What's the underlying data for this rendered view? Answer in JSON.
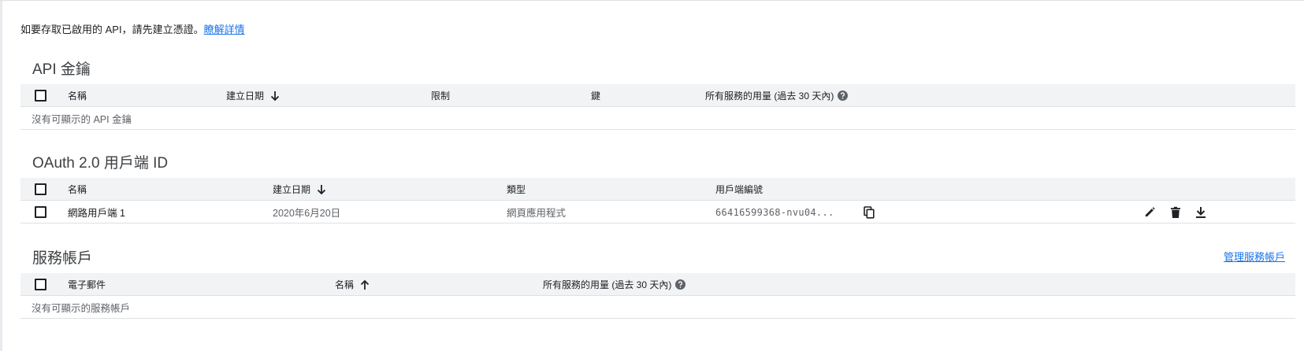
{
  "intro": {
    "text": "如要存取已啟用的 API，請先建立憑證。",
    "link": "瞭解詳情"
  },
  "api_keys": {
    "title": "API 金鑰",
    "headers": {
      "name": "名稱",
      "created": "建立日期",
      "restrictions": "限制",
      "key": "鍵",
      "usage": "所有服務的用量 (過去 30 天內)"
    },
    "empty": "沒有可顯示的 API 金鑰"
  },
  "oauth": {
    "title": "OAuth 2.0 用戶端 ID",
    "headers": {
      "name": "名稱",
      "created": "建立日期",
      "type": "類型",
      "client_id": "用戶端編號"
    },
    "rows": [
      {
        "name": "網路用戶端 1",
        "created": "2020年6月20日",
        "type": "網頁應用程式",
        "client_id": "66416599368-nvu04..."
      }
    ]
  },
  "service_accounts": {
    "title": "服務帳戶",
    "manage_link": "管理服務帳戶",
    "headers": {
      "email": "電子郵件",
      "name": "名稱",
      "usage": "所有服務的用量 (過去 30 天內)"
    },
    "empty": "沒有可顯示的服務帳戶"
  },
  "icons": {
    "checkbox": "checkbox-icon",
    "sort_down": "arrow-down-icon",
    "sort_up": "arrow-up-icon",
    "help": "help-icon",
    "copy": "copy-icon",
    "edit": "pencil-icon",
    "delete": "trash-icon",
    "download": "download-icon"
  },
  "colors": {
    "link": "#1a73e8",
    "header_bg": "#f1f3f4",
    "divider": "#e0e0e0"
  }
}
